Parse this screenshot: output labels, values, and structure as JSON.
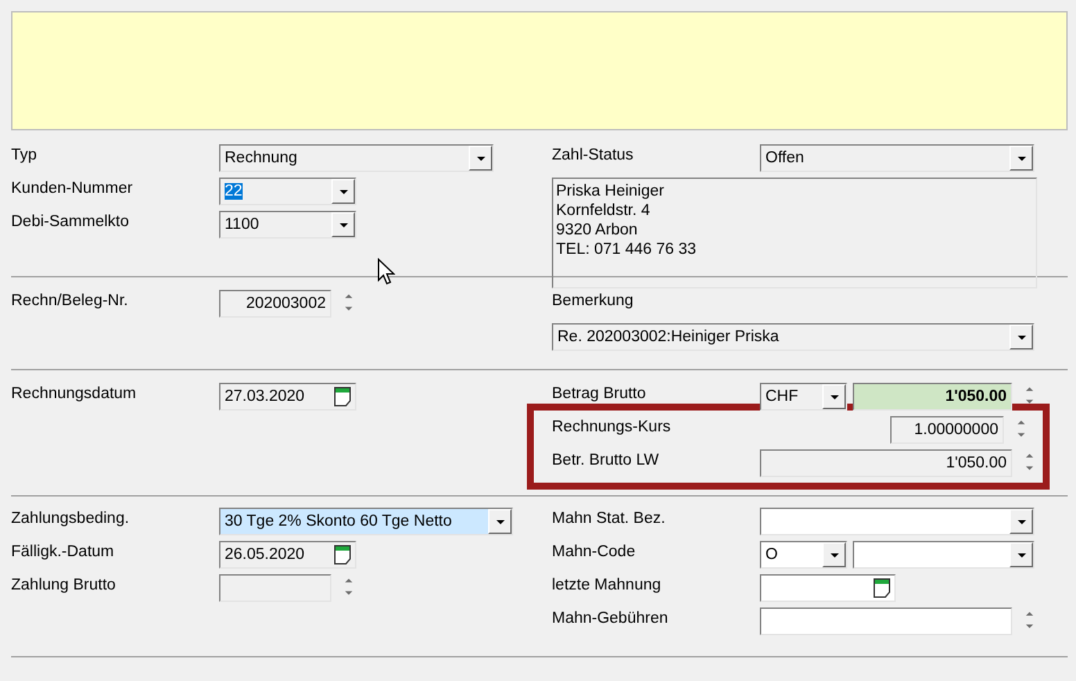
{
  "sections": [
    {
      "left": [
        {
          "label": "Typ",
          "controls": [
            {
              "kind": "combo",
              "value": "Rechnung",
              "editable": false
            }
          ]
        },
        {
          "label": "Kunden-Nummer",
          "controls": [
            {
              "kind": "combo",
              "value": "22",
              "editable": false,
              "text_selected": true
            }
          ]
        },
        {
          "label": "Debi-Sammelkto",
          "controls": [
            {
              "kind": "combo",
              "value": "1100",
              "editable": false
            }
          ]
        }
      ],
      "right": [
        {
          "label": "Zahl-Status",
          "controls": [
            {
              "kind": "combo",
              "value": "Offen",
              "editable": false
            }
          ]
        },
        {
          "controls": [
            {
              "kind": "memo",
              "lines": [
                "Priska Heiniger",
                "Kornfeldstr. 4",
                "9320 Arbon",
                "TEL: 071 446 76 33"
              ],
              "editable": false
            }
          ]
        }
      ]
    },
    {
      "left": [
        {
          "label": "Rechn/Beleg-Nr.",
          "controls": [
            {
              "kind": "spin",
              "value": "202003002",
              "editable": false
            }
          ]
        }
      ],
      "right": [
        {
          "label": "Bemerkung"
        },
        {
          "controls": [
            {
              "kind": "combo",
              "value": "Re.  202003002:Heiniger Priska",
              "editable": false
            }
          ]
        }
      ]
    },
    {
      "left": [
        {
          "label": "Rechnungsdatum",
          "controls": [
            {
              "kind": "date",
              "value": "27.03.2020",
              "editable": false
            }
          ]
        }
      ],
      "right": [
        {
          "label": "Betrag Brutto",
          "controls": [
            {
              "kind": "combo",
              "value": "CHF",
              "editable": false
            },
            {
              "kind": "amount",
              "value": "1'050.00"
            }
          ]
        },
        {
          "label": "Rechnungs-Kurs",
          "framed": true,
          "controls": [
            {
              "kind": "spin",
              "value": "1.00000000",
              "editable": false
            }
          ]
        },
        {
          "label": "Betr. Brutto LW",
          "framed": true,
          "controls": [
            {
              "kind": "spin",
              "value": "1'050.00",
              "editable": false
            }
          ]
        }
      ]
    },
    {
      "left": [
        {
          "label": "Zahlungsbeding.",
          "controls": [
            {
              "kind": "combo",
              "value": "30 Tge 2% Skonto 60 Tge Netto",
              "highlighted": true
            }
          ]
        },
        {
          "label": "Fälligk.-Datum",
          "controls": [
            {
              "kind": "date",
              "value": "26.05.2020",
              "editable": false
            }
          ]
        },
        {
          "label": "Zahlung Brutto",
          "controls": [
            {
              "kind": "spin",
              "editable": false
            }
          ]
        }
      ],
      "right": [
        {
          "label": "Mahn Stat. Bez.",
          "controls": [
            {
              "kind": "combo",
              "editable": true
            }
          ]
        },
        {
          "label": "Mahn-Code",
          "controls": [
            {
              "kind": "combo",
              "value": "O",
              "editable": true
            },
            {
              "kind": "combo",
              "editable": true
            }
          ]
        },
        {
          "label": "letzte Mahnung",
          "controls": [
            {
              "kind": "date",
              "editable": true
            }
          ]
        },
        {
          "label": "Mahn-Gebühren",
          "controls": [
            {
              "kind": "spin",
              "editable": true
            }
          ]
        }
      ]
    }
  ]
}
